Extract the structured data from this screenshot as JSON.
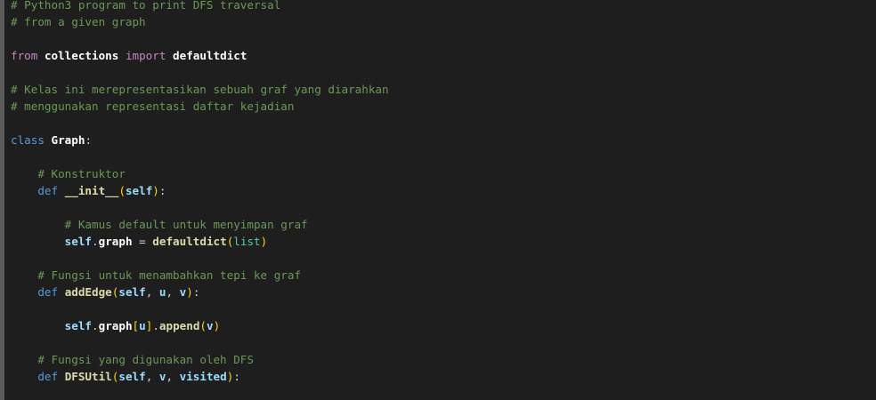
{
  "lines": [
    [
      {
        "t": "# Python3 program to print DFS traversal",
        "c": "comment"
      }
    ],
    [
      {
        "t": "# from a given graph",
        "c": "comment"
      }
    ],
    [],
    [
      {
        "t": "from",
        "c": "kw-import"
      },
      {
        "t": " ",
        "c": "plain"
      },
      {
        "t": "collections",
        "c": "bold"
      },
      {
        "t": " ",
        "c": "plain"
      },
      {
        "t": "import",
        "c": "kw-import"
      },
      {
        "t": " ",
        "c": "plain"
      },
      {
        "t": "defaultdict",
        "c": "bold"
      }
    ],
    [],
    [
      {
        "t": "# Kelas ini merepresentasikan sebuah graf yang diarahkan",
        "c": "comment"
      }
    ],
    [
      {
        "t": "# menggunakan representasi daftar kejadian",
        "c": "comment"
      }
    ],
    [],
    [
      {
        "t": "class",
        "c": "kw"
      },
      {
        "t": " ",
        "c": "plain"
      },
      {
        "t": "Graph",
        "c": "bold"
      },
      {
        "t": ":",
        "c": "plain"
      }
    ],
    [],
    [
      {
        "t": "    ",
        "c": "plain"
      },
      {
        "t": "# Konstruktor",
        "c": "comment"
      }
    ],
    [
      {
        "t": "    ",
        "c": "plain"
      },
      {
        "t": "def",
        "c": "kw"
      },
      {
        "t": " ",
        "c": "plain"
      },
      {
        "t": "__init__",
        "c": "fn"
      },
      {
        "t": "(",
        "c": "paren1"
      },
      {
        "t": "self",
        "c": "param"
      },
      {
        "t": ")",
        "c": "paren1"
      },
      {
        "t": ":",
        "c": "plain"
      }
    ],
    [],
    [
      {
        "t": "        ",
        "c": "plain"
      },
      {
        "t": "# Kamus default untuk menyimpan graf",
        "c": "comment"
      }
    ],
    [
      {
        "t": "        ",
        "c": "plain"
      },
      {
        "t": "self",
        "c": "param"
      },
      {
        "t": ".",
        "c": "plain"
      },
      {
        "t": "graph",
        "c": "bold"
      },
      {
        "t": " = ",
        "c": "plain"
      },
      {
        "t": "defaultdict",
        "c": "fn"
      },
      {
        "t": "(",
        "c": "paren1"
      },
      {
        "t": "list",
        "c": "builtin"
      },
      {
        "t": ")",
        "c": "paren1"
      }
    ],
    [],
    [
      {
        "t": "    ",
        "c": "plain"
      },
      {
        "t": "# Fungsi untuk menambahkan tepi ke graf",
        "c": "comment"
      }
    ],
    [
      {
        "t": "    ",
        "c": "plain"
      },
      {
        "t": "def",
        "c": "kw"
      },
      {
        "t": " ",
        "c": "plain"
      },
      {
        "t": "addEdge",
        "c": "fn"
      },
      {
        "t": "(",
        "c": "paren1"
      },
      {
        "t": "self",
        "c": "param"
      },
      {
        "t": ", ",
        "c": "plain"
      },
      {
        "t": "u",
        "c": "param"
      },
      {
        "t": ", ",
        "c": "plain"
      },
      {
        "t": "v",
        "c": "param"
      },
      {
        "t": ")",
        "c": "paren1"
      },
      {
        "t": ":",
        "c": "plain"
      }
    ],
    [],
    [
      {
        "t": "        ",
        "c": "plain"
      },
      {
        "t": "self",
        "c": "param"
      },
      {
        "t": ".",
        "c": "plain"
      },
      {
        "t": "graph",
        "c": "bold"
      },
      {
        "t": "[",
        "c": "paren1"
      },
      {
        "t": "u",
        "c": "param"
      },
      {
        "t": "]",
        "c": "paren1"
      },
      {
        "t": ".",
        "c": "plain"
      },
      {
        "t": "append",
        "c": "fn"
      },
      {
        "t": "(",
        "c": "paren1"
      },
      {
        "t": "v",
        "c": "param"
      },
      {
        "t": ")",
        "c": "paren1"
      }
    ],
    [],
    [
      {
        "t": "    ",
        "c": "plain"
      },
      {
        "t": "# Fungsi yang digunakan oleh DFS",
        "c": "comment"
      }
    ],
    [
      {
        "t": "    ",
        "c": "plain"
      },
      {
        "t": "def",
        "c": "kw"
      },
      {
        "t": " ",
        "c": "plain"
      },
      {
        "t": "DFSUtil",
        "c": "fn"
      },
      {
        "t": "(",
        "c": "paren1"
      },
      {
        "t": "self",
        "c": "param"
      },
      {
        "t": ", ",
        "c": "plain"
      },
      {
        "t": "v",
        "c": "param"
      },
      {
        "t": ", ",
        "c": "plain"
      },
      {
        "t": "visited",
        "c": "param"
      },
      {
        "t": ")",
        "c": "paren1"
      },
      {
        "t": ":",
        "c": "plain"
      }
    ]
  ]
}
